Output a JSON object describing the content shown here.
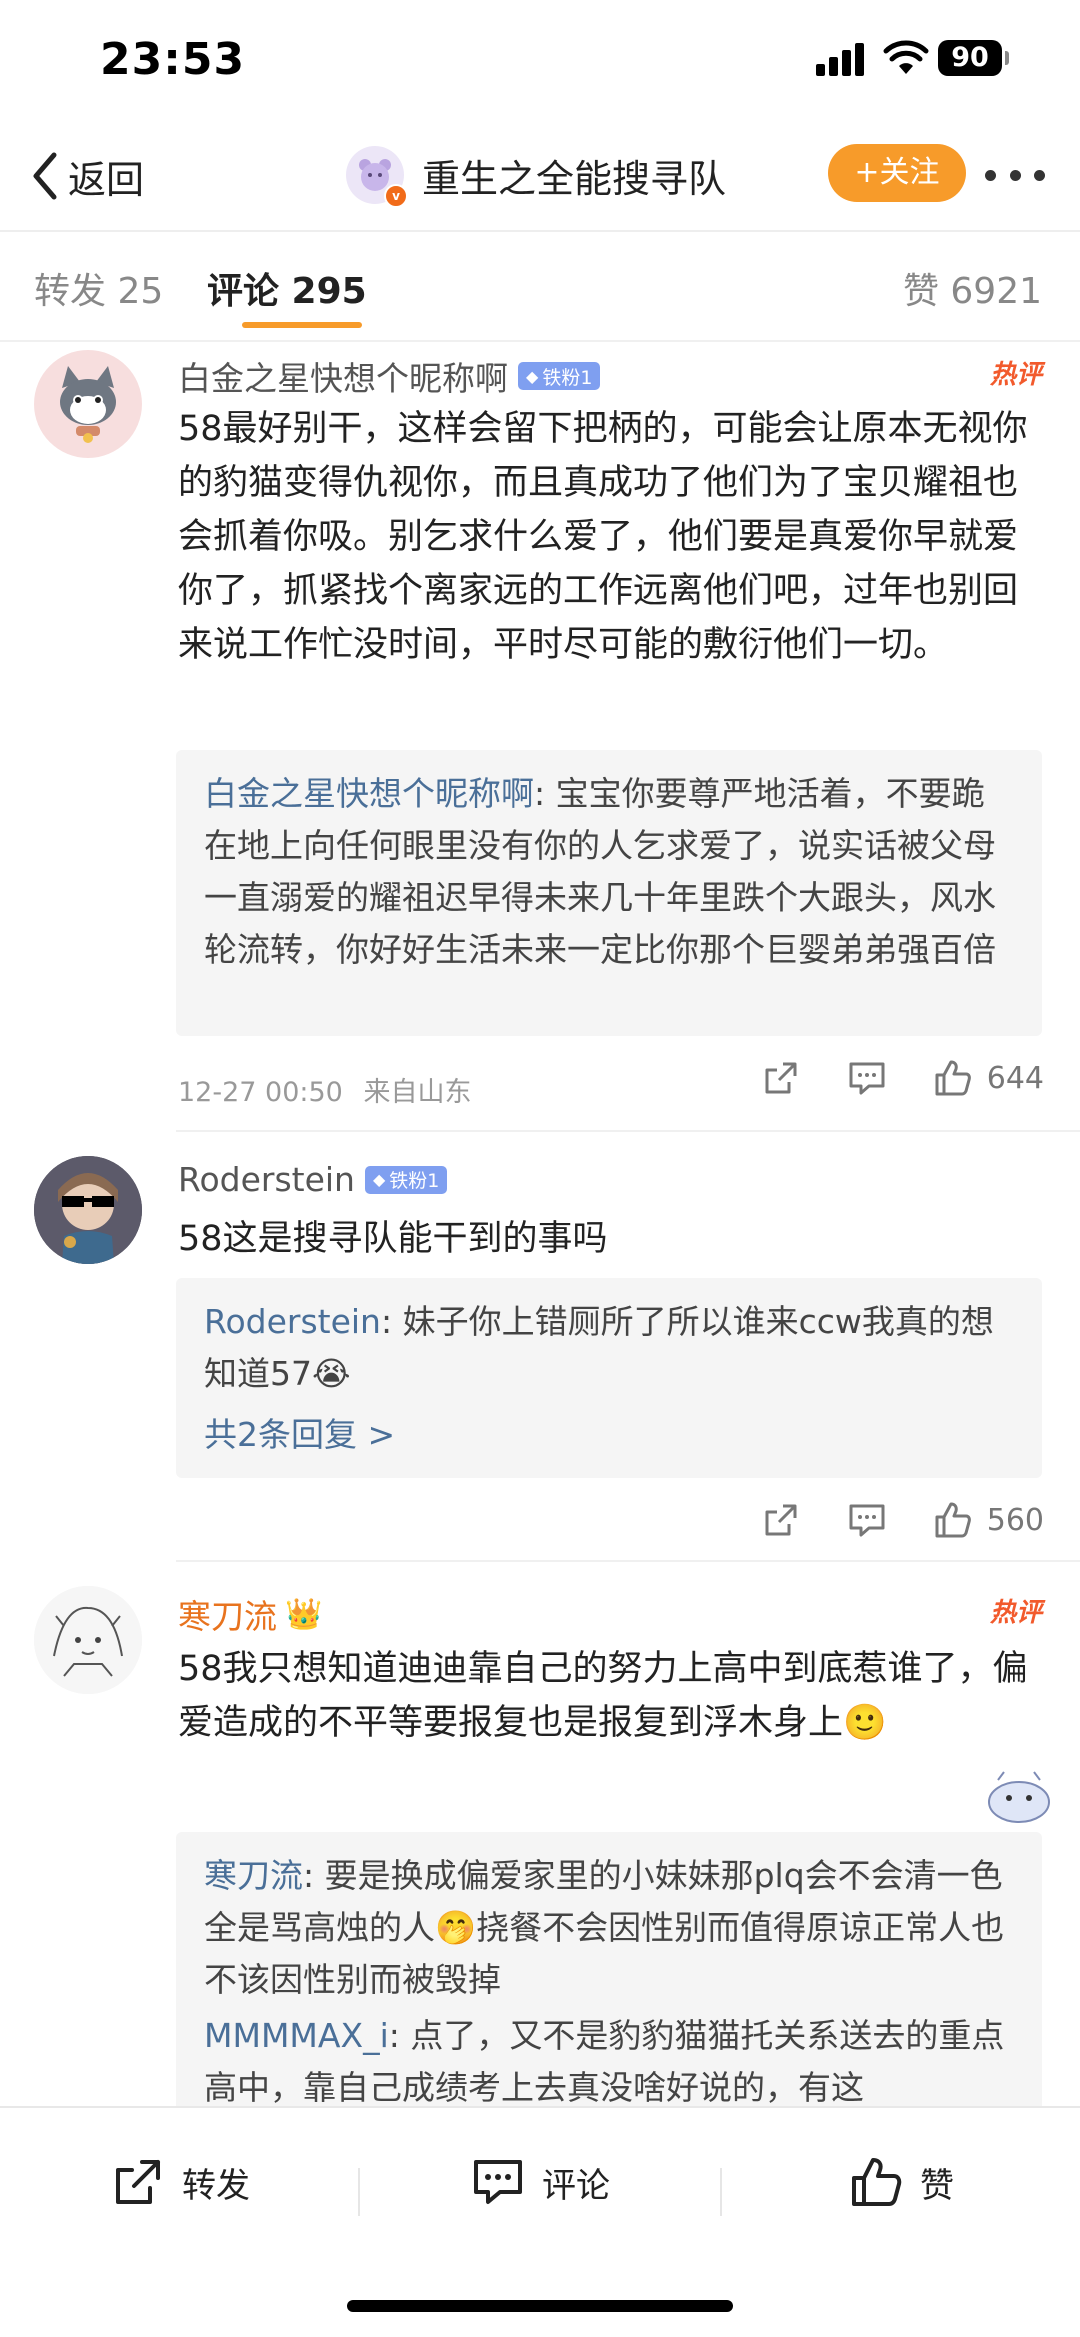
{
  "status_bar": {
    "time": "23:53",
    "battery": "90"
  },
  "nav": {
    "back_label": "返回",
    "title": "重生之全能搜寻队",
    "follow_label": "+关注"
  },
  "tabs": {
    "repost": "转发 25",
    "comment": "评论 295",
    "like": "赞 6921"
  },
  "colors": {
    "accent": "#f79b2a",
    "link": "#4a6f98",
    "hot": "#f25a2c",
    "fan_badge": "#7f9ff0"
  },
  "comments": [
    {
      "name": "白金之星快想个昵称啊",
      "badge": "铁粉1",
      "hot_label": "热评",
      "text": "58最好别干，这样会留下把柄的，可能会让原本无视你的豹猫变得仇视你，而且真成功了他们为了宝贝耀祖也会抓着你吸。别乞求什么爱了，他们要是真爱你早就爱你了，抓紧找个离家远的工作远离他们吧，过年也别回来说工作忙没时间，平时尽可能的敷衍他们一切。",
      "replies": [
        {
          "name": "白金之星快想个昵称啊",
          "text": ": 宝宝你要尊严地活着，不要跪在地上向任何眼里没有你的人乞求爱了，说实话被父母一直溺爱的耀祖迟早得未来几十年里跌个大跟头，风水轮流转，你好好生活未来一定比你那个巨婴弟弟强百倍"
        }
      ],
      "time": "12-27 00:50",
      "location": "来自山东",
      "likes": "644"
    },
    {
      "name": "Roderstein",
      "badge": "铁粉1",
      "text": "58这是搜寻队能干到的事吗",
      "replies": [
        {
          "name": "Roderstein",
          "text": ": 妹子你上错厕所了所以谁来ccw我真的想知道57😭"
        }
      ],
      "more_replies": "共2条回复 >",
      "likes": "560"
    },
    {
      "name": "寒刀流",
      "hot_label": "热评",
      "text": "58我只想知道迪迪靠自己的努力上高中到底惹谁了，偏爱造成的不平等要报复也是报复到浮木身上🙂",
      "replies": [
        {
          "name": "寒刀流",
          "text": ": 要是换成偏爱家里的小妹妹那plq会不会清一色全是骂高烛的人🤭挠餐不会因性别而值得原谅正常人也不该因性别而被毁掉"
        },
        {
          "name": "MMMMAX_i",
          "text": ": 点了，又不是豹豹猫猫托关系送去的重点高中，靠自己成绩考上去真没啥好说的，有这"
        }
      ]
    }
  ],
  "toolbar": {
    "repost": "转发",
    "comment": "评论",
    "like": "赞"
  },
  "icons": {
    "back": "chevron-left-icon",
    "more": "more-icon",
    "share": "share-icon",
    "comment": "comment-icon",
    "like": "thumbs-up-icon",
    "signal": "signal-icon",
    "wifi": "wifi-icon"
  }
}
